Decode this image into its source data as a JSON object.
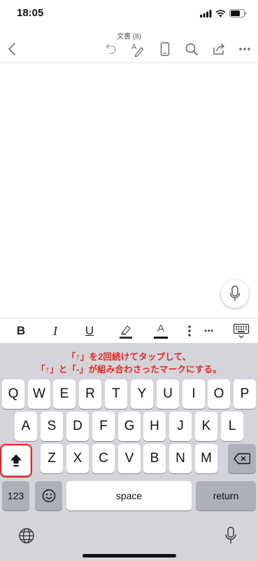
{
  "status": {
    "time": "18:05"
  },
  "toolbar": {
    "doc_title": "文書 (8)"
  },
  "format_bar": {
    "bold": "B",
    "italic": "I",
    "underline": "U",
    "font_color": "A",
    "more": "•••"
  },
  "annotation": {
    "line1": "「↑」を2回続けてタップして、",
    "line2": "「↑」と「-」が組み合わさったマークにする。"
  },
  "keyboard": {
    "row1": [
      "Q",
      "W",
      "E",
      "R",
      "T",
      "Y",
      "U",
      "I",
      "O",
      "P"
    ],
    "row2": [
      "A",
      "S",
      "D",
      "F",
      "G",
      "H",
      "J",
      "K",
      "L"
    ],
    "row3": [
      "Z",
      "X",
      "C",
      "V",
      "B",
      "N",
      "M"
    ],
    "numbers_label": "123",
    "space_label": "space",
    "return_label": "return"
  },
  "colors": {
    "annotation": "#e8251f",
    "keyboard_bg": "#d3d5db"
  }
}
